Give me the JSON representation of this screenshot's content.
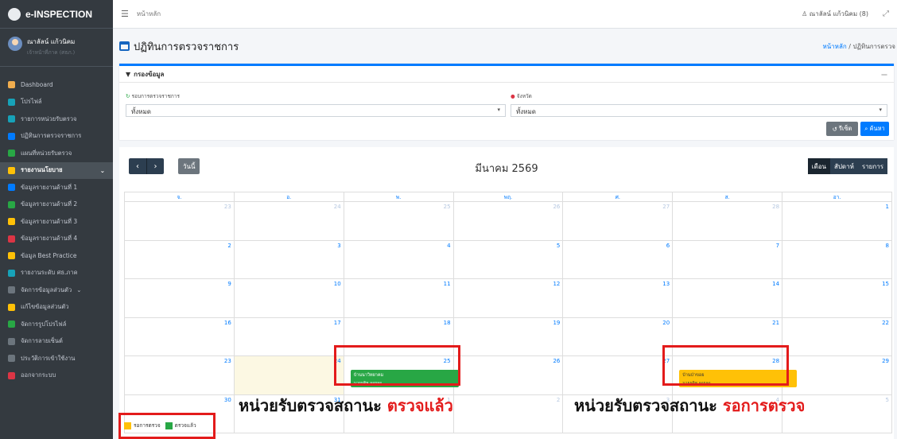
{
  "brand": {
    "name": "e-INSPECTION"
  },
  "user": {
    "name": "ณาลัลน์ แก้วนิคม",
    "role": "เจ้าหน้าที่ภาค (ศธภ.)"
  },
  "sidebar": {
    "items": [
      {
        "label": "Dashboard",
        "icon": "dashboard-icon",
        "color": "#f0ad4e"
      },
      {
        "label": "โปรไฟล์",
        "icon": "user-icon",
        "color": "#17a2b8"
      },
      {
        "label": "รายการหน่วยรับตรวจ",
        "icon": "list-icon",
        "color": "#17a2b8"
      },
      {
        "label": "ปฏิทินการตรวจราชการ",
        "icon": "calendar-icon",
        "color": "#007bff"
      },
      {
        "label": "แผนที่หน่วยรับตรวจ",
        "icon": "map-icon",
        "color": "#28a745"
      },
      {
        "label": "รายงานนโยบาย",
        "icon": "file-icon",
        "color": "#ffc107",
        "active": true
      },
      {
        "label": "ข้อมูลรายงานด้านที่ 1",
        "icon": "doc-icon",
        "color": "#007bff"
      },
      {
        "label": "ข้อมูลรายงานด้านที่ 2",
        "icon": "doc-icon",
        "color": "#28a745"
      },
      {
        "label": "ข้อมูลรายงานด้านที่ 3",
        "icon": "doc-icon",
        "color": "#ffc107"
      },
      {
        "label": "ข้อมูลรายงานด้านที่ 4",
        "icon": "doc-icon",
        "color": "#dc3545"
      },
      {
        "label": "ข้อมูล Best Practice",
        "icon": "medal-icon",
        "color": "#ffc107"
      },
      {
        "label": "รายงานระดับ ศธ.ภาค",
        "icon": "chart-icon",
        "color": "#17a2b8"
      },
      {
        "label": "จัดการข้อมูลส่วนตัว",
        "icon": "cog-icon",
        "color": "#6c757d",
        "section": true
      },
      {
        "label": "แก้ไขข้อมูลส่วนตัว",
        "icon": "user-edit-icon",
        "color": "#ffc107"
      },
      {
        "label": "จัดการรูปโปรไฟล์",
        "icon": "image-icon",
        "color": "#28a745"
      },
      {
        "label": "จัดการลายเซ็นต์",
        "icon": "sign-icon",
        "color": "#6c757d"
      },
      {
        "label": "ประวัติการเข้าใช้งาน",
        "icon": "history-icon",
        "color": "#6c757d"
      },
      {
        "label": "ออกจากระบบ",
        "icon": "logout-icon",
        "color": "#dc3545"
      }
    ]
  },
  "topbar": {
    "breadcrumb": "หน้าหลัก",
    "user": "ณาลัลน์ แก้วนิคม (8)"
  },
  "header": {
    "title": "ปฏิทินการตรวจราชการ",
    "crumb_home": "หน้าหลัก",
    "crumb_sep": "/",
    "crumb_current": "ปฏิทินการตรวจ"
  },
  "filter": {
    "title": "กรองข้อมูล",
    "round_label": "รอบการตรวจราชการ",
    "round_value": "ทั้งหมด",
    "province_label": "จังหวัด",
    "province_value": "ทั้งหมด",
    "reset": "รีเซ็ต",
    "search": "ค้นหา"
  },
  "calendar": {
    "today_btn": "วันนี้",
    "month": "มีนาคม 2569",
    "views": [
      "เดือน",
      "สัปดาห์",
      "รายการ"
    ],
    "weekdays": [
      "จ.",
      "อ.",
      "พ.",
      "พฤ.",
      "ศ.",
      "ส.",
      "อา."
    ],
    "weeks": [
      [
        "23",
        "24",
        "25",
        "26",
        "27",
        "28",
        "1"
      ],
      [
        "2",
        "3",
        "4",
        "5",
        "6",
        "7",
        "8"
      ],
      [
        "9",
        "10",
        "11",
        "12",
        "13",
        "14",
        "15"
      ],
      [
        "16",
        "17",
        "18",
        "19",
        "20",
        "21",
        "22"
      ],
      [
        "23",
        "24",
        "25",
        "26",
        "27",
        "28",
        "29"
      ],
      [
        "30",
        "31",
        "1",
        "2",
        "3",
        "4",
        "5"
      ]
    ],
    "events": [
      {
        "title": "บ้านนาวิทยาคม",
        "sub": "นายธุติพ ลอยลอ",
        "status_color": "#28a745"
      },
      {
        "title": "บ้านป่าขอย",
        "sub": "นายธุติพ ลอยลอ",
        "status_color": "#ffc107"
      }
    ]
  },
  "annotations": {
    "done_prefix": "หน่วยรับตรวจสถานะ ",
    "done_status": "ตรวจแล้ว",
    "wait_prefix": "หน่วยรับตรวจสถานะ ",
    "wait_status": "รอการตรวจ"
  },
  "legend": [
    {
      "label": "รอการตรวจ",
      "color": "#ffc107"
    },
    {
      "label": "ตรวจแล้ว",
      "color": "#28a745"
    }
  ]
}
